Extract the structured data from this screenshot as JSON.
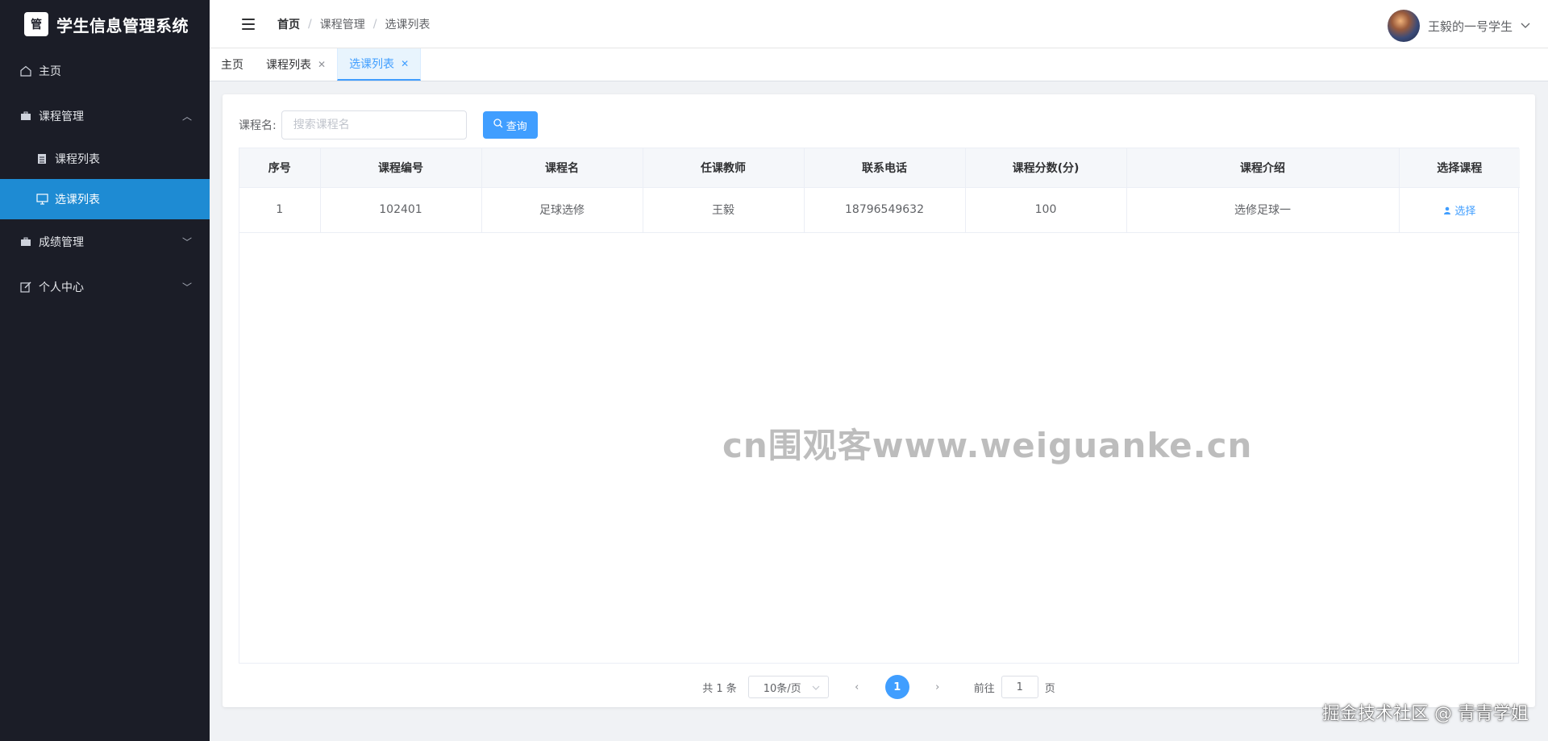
{
  "app": {
    "title": "学生信息管理系统",
    "logo_text": "管"
  },
  "sidebar": {
    "items": [
      {
        "label": "主页",
        "icon": "home-icon"
      },
      {
        "label": "课程管理",
        "icon": "briefcase-icon",
        "expanded": true,
        "children": [
          {
            "label": "课程列表",
            "icon": "clipboard-icon"
          },
          {
            "label": "选课列表",
            "icon": "monitor-icon",
            "active": true
          }
        ]
      },
      {
        "label": "成绩管理",
        "icon": "briefcase-icon"
      },
      {
        "label": "个人中心",
        "icon": "edit-icon"
      }
    ]
  },
  "header": {
    "breadcrumb": [
      "首页",
      "课程管理",
      "选课列表"
    ],
    "separator": "/",
    "user_name": "王毅的一号学生"
  },
  "tabs": [
    {
      "label": "主页",
      "closable": false
    },
    {
      "label": "课程列表",
      "closable": true
    },
    {
      "label": "选课列表",
      "closable": true,
      "active": true
    }
  ],
  "search": {
    "label": "课程名:",
    "placeholder": "搜索课程名",
    "value": "",
    "button_label": "查询"
  },
  "table": {
    "columns": [
      "序号",
      "课程编号",
      "课程名",
      "任课教师",
      "联系电话",
      "课程分数(分)",
      "课程介绍",
      "选择课程"
    ],
    "rows": [
      [
        "1",
        "102401",
        "足球选修",
        "王毅",
        "18796549632",
        "100",
        "选修足球一",
        "选择"
      ]
    ]
  },
  "pagination": {
    "total_text": "共 1 条",
    "page_size": "10条/页",
    "current_page": "1",
    "goto_label": "前往",
    "goto_value": "1",
    "goto_suffix": "页"
  },
  "watermark": "cn围观客www.weiguanke.cn",
  "footer_credit": "掘金技术社区 @ 青青学姐",
  "colors": {
    "sidebar_bg": "#1b1d27",
    "active_menu": "#1e8bd3",
    "primary": "#409eff"
  }
}
